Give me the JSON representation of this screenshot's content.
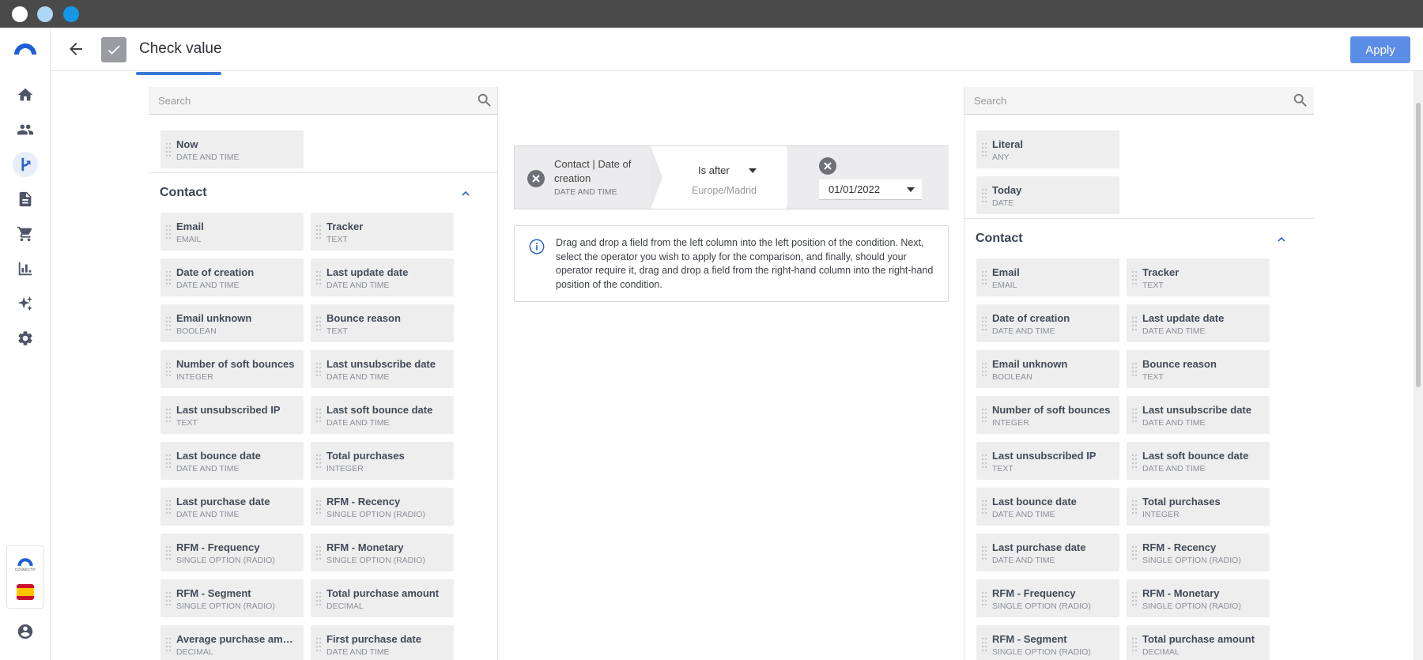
{
  "header": {
    "title": "Check value",
    "apply_label": "Apply"
  },
  "left_panel": {
    "search_placeholder": "Search",
    "top_fields": [
      {
        "name": "Now",
        "type": "DATE AND TIME"
      }
    ],
    "section_title": "Contact",
    "fields": [
      {
        "name": "Email",
        "type": "EMAIL"
      },
      {
        "name": "Tracker",
        "type": "TEXT"
      },
      {
        "name": "Date of creation",
        "type": "DATE AND TIME"
      },
      {
        "name": "Last update date",
        "type": "DATE AND TIME"
      },
      {
        "name": "Email unknown",
        "type": "BOOLEAN"
      },
      {
        "name": "Bounce reason",
        "type": "TEXT"
      },
      {
        "name": "Number of soft bounces",
        "type": "INTEGER"
      },
      {
        "name": "Last unsubscribe date",
        "type": "DATE AND TIME"
      },
      {
        "name": "Last unsubscribed IP",
        "type": "TEXT"
      },
      {
        "name": "Last soft bounce date",
        "type": "DATE AND TIME"
      },
      {
        "name": "Last bounce date",
        "type": "DATE AND TIME"
      },
      {
        "name": "Total purchases",
        "type": "INTEGER"
      },
      {
        "name": "Last purchase date",
        "type": "DATE AND TIME"
      },
      {
        "name": "RFM - Recency",
        "type": "SINGLE OPTION (RADIO)"
      },
      {
        "name": "RFM - Frequency",
        "type": "SINGLE OPTION (RADIO)"
      },
      {
        "name": "RFM - Monetary",
        "type": "SINGLE OPTION (RADIO)"
      },
      {
        "name": "RFM - Segment",
        "type": "SINGLE OPTION (RADIO)"
      },
      {
        "name": "Total purchase amount",
        "type": "DECIMAL"
      },
      {
        "name": "Average purchase amo…",
        "type": "DECIMAL"
      },
      {
        "name": "First purchase date",
        "type": "DATE AND TIME"
      }
    ]
  },
  "right_panel": {
    "search_placeholder": "Search",
    "top_fields": [
      {
        "name": "Literal",
        "type": "ANY"
      },
      {
        "name": "Today",
        "type": "DATE"
      }
    ],
    "section_title": "Contact",
    "fields": [
      {
        "name": "Email",
        "type": "EMAIL"
      },
      {
        "name": "Tracker",
        "type": "TEXT"
      },
      {
        "name": "Date of creation",
        "type": "DATE AND TIME"
      },
      {
        "name": "Last update date",
        "type": "DATE AND TIME"
      },
      {
        "name": "Email unknown",
        "type": "BOOLEAN"
      },
      {
        "name": "Bounce reason",
        "type": "TEXT"
      },
      {
        "name": "Number of soft bounces",
        "type": "INTEGER"
      },
      {
        "name": "Last unsubscribe date",
        "type": "DATE AND TIME"
      },
      {
        "name": "Last unsubscribed IP",
        "type": "TEXT"
      },
      {
        "name": "Last soft bounce date",
        "type": "DATE AND TIME"
      },
      {
        "name": "Last bounce date",
        "type": "DATE AND TIME"
      },
      {
        "name": "Total purchases",
        "type": "INTEGER"
      },
      {
        "name": "Last purchase date",
        "type": "DATE AND TIME"
      },
      {
        "name": "RFM - Recency",
        "type": "SINGLE OPTION (RADIO)"
      },
      {
        "name": "RFM - Frequency",
        "type": "SINGLE OPTION (RADIO)"
      },
      {
        "name": "RFM - Monetary",
        "type": "SINGLE OPTION (RADIO)"
      },
      {
        "name": "RFM - Segment",
        "type": "SINGLE OPTION (RADIO)"
      },
      {
        "name": "Total purchase amount",
        "type": "DECIMAL"
      }
    ]
  },
  "condition": {
    "left_field_line1": "Contact | Date of",
    "left_field_line2": "creation",
    "left_field_type": "DATE AND TIME",
    "operator": "Is after",
    "timezone": "Europe/Madrid",
    "value": "01/01/2022"
  },
  "info_text": "Drag and drop a field from the left column into the left position of the condition. Next, select the operator you wish to apply for the comparison, and finally, should your operator require it, drag and drop a field from the right-hand column into the right-hand position of the condition.",
  "sidebar": {
    "icons": [
      "home-icon",
      "contacts-icon",
      "flows-icon",
      "documents-icon",
      "cart-icon",
      "analytics-icon",
      "sparkle-icon",
      "settings-icon"
    ],
    "brand_text": "CONNECTIF"
  },
  "colors": {
    "accent": "#3a78d6",
    "apply": "#5c8de6",
    "titlebar": "#4a4a4a"
  }
}
